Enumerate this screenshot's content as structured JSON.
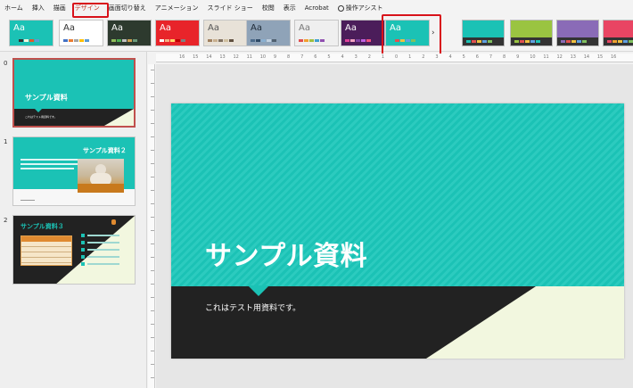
{
  "ribbon": {
    "tabs": [
      "ホーム",
      "挿入",
      "描画",
      "デザイン",
      "画面切り替え",
      "アニメーション",
      "スライド ショー",
      "校閲",
      "表示",
      "Acrobat"
    ],
    "active_tab": "デザイン",
    "help_label": "操作アシスト"
  },
  "gallery": {
    "themes": [
      {
        "aa": "Aa",
        "bg": "#1bc2b5",
        "fg": "#ffffff",
        "bars": [
          "#1bc2b5",
          "#333333",
          "#f2f7df",
          "#e05a2b",
          "#5a9bd5"
        ]
      },
      {
        "aa": "Aa",
        "bg": "#ffffff",
        "fg": "#333333",
        "bars": [
          "#4472c4",
          "#ed7d31",
          "#a5a5a5",
          "#ffc000",
          "#5b9bd5"
        ]
      },
      {
        "aa": "Aa",
        "bg": "#2d3a2e",
        "fg": "#ffffff",
        "bars": [
          "#8fbc5a",
          "#4caf50",
          "#c0c0c0",
          "#d0a050",
          "#6a9a7a"
        ]
      },
      {
        "aa": "Aa",
        "bg": "#e8242a",
        "fg": "#ffffff",
        "bars": [
          "#ffffff",
          "#f4b183",
          "#ffd966",
          "#c00000",
          "#808080"
        ]
      },
      {
        "aa": "Aa",
        "bg": "#e8e2d8",
        "fg": "#555555",
        "bars": [
          "#a08060",
          "#c8b090",
          "#807060",
          "#d0c0a0",
          "#605040"
        ]
      },
      {
        "aa": "Aa",
        "bg": "#8fa3b8",
        "fg": "#1e2a36",
        "bars": [
          "#4a6a8a",
          "#2e4a66",
          "#8ab0d0",
          "#c0d0e0",
          "#506070"
        ]
      },
      {
        "aa": "Aa",
        "bg": "#efefef",
        "fg": "#777777",
        "bars": [
          "#e15050",
          "#f0a030",
          "#a0c040",
          "#40a0d0",
          "#9050b0"
        ]
      },
      {
        "aa": "Aa",
        "bg": "#4b1d5a",
        "fg": "#ffffff",
        "bars": [
          "#e0409a",
          "#f0a0c0",
          "#8040a0",
          "#c060e0",
          "#f05080"
        ]
      },
      {
        "aa": "Aa",
        "bg": "#1bc2b5",
        "fg": "#ffffff",
        "bars": [
          "#1bc2b5",
          "#e05050",
          "#f0c040",
          "#60a0e0",
          "#80c060"
        ]
      }
    ],
    "more_glyph": "›",
    "variants": [
      {
        "top": "#1bc2b5",
        "bottom": "#333333",
        "bars": [
          "#1bc2b5",
          "#e05050",
          "#f0c040",
          "#60a0e0",
          "#80c060"
        ]
      },
      {
        "top": "#9ac441",
        "bottom": "#333333",
        "bars": [
          "#9ac441",
          "#e05050",
          "#f0c040",
          "#60a0e0",
          "#1bc2b5"
        ]
      },
      {
        "top": "#8a6bb7",
        "bottom": "#333333",
        "bars": [
          "#8a6bb7",
          "#e05050",
          "#f0c040",
          "#60a0e0",
          "#80c060"
        ]
      },
      {
        "top": "#e94563",
        "bottom": "#333333",
        "bars": [
          "#e94563",
          "#f0a030",
          "#f0c040",
          "#60a0e0",
          "#80c060"
        ]
      }
    ]
  },
  "slides": [
    {
      "number": "0",
      "title": "サンプル資料",
      "subtitle": "これはテスト用資料です。"
    },
    {
      "number": "1",
      "title": "サンプル資料２"
    },
    {
      "number": "2",
      "title": "サンプル資料３"
    }
  ],
  "ruler": {
    "labels": [
      "16",
      "15",
      "14",
      "13",
      "12",
      "11",
      "10",
      "9",
      "8",
      "7",
      "6",
      "5",
      "4",
      "3",
      "2",
      "1",
      "0",
      "1",
      "2",
      "3",
      "4",
      "5",
      "6",
      "7",
      "8",
      "9",
      "10",
      "11",
      "12",
      "13",
      "14",
      "15",
      "16"
    ]
  },
  "slide": {
    "title": "サンプル資料",
    "subtitle": "これはテスト用資料です。",
    "colors": {
      "teal": "#1bc2b5",
      "dark": "#222222",
      "cream": "#f2f7df"
    }
  }
}
